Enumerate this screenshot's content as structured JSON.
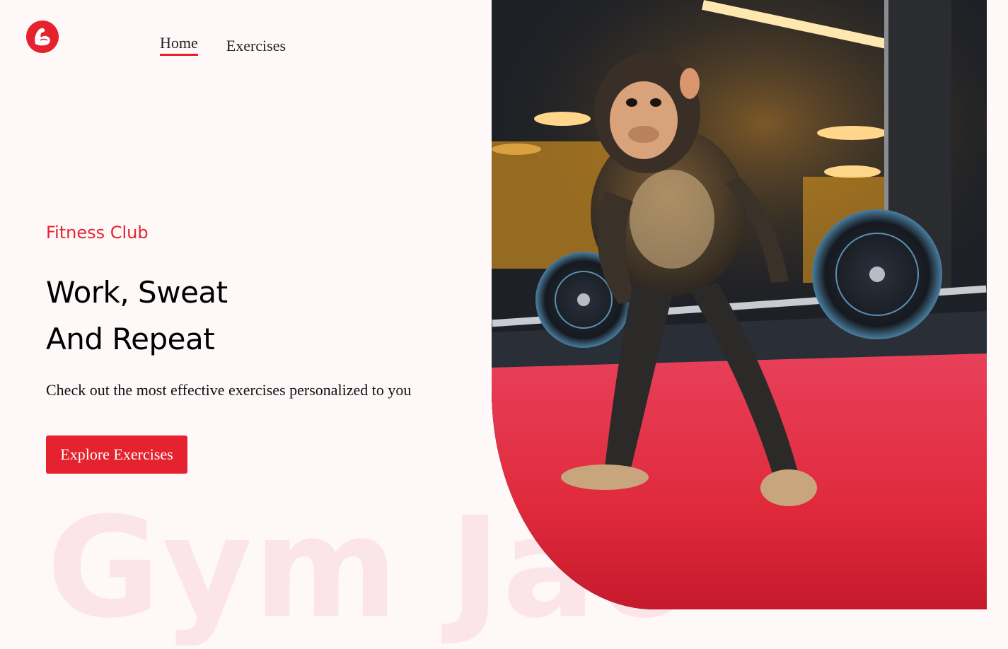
{
  "brand": {
    "logo_icon": "flexed-bicep-icon",
    "accent_color": "#e5232f"
  },
  "nav": {
    "items": [
      {
        "label": "Home",
        "active": true
      },
      {
        "label": "Exercises",
        "active": false
      }
    ]
  },
  "hero": {
    "eyebrow": "Fitness Club",
    "headline_line1": "Work, Sweat",
    "headline_line2": "And Repeat",
    "subtitle": "Check out the most effective exercises personalized to you",
    "cta_label": "Explore Exercises",
    "watermark": "Gym Jao",
    "image_subject": "monkey-lifting-barbell-image"
  }
}
